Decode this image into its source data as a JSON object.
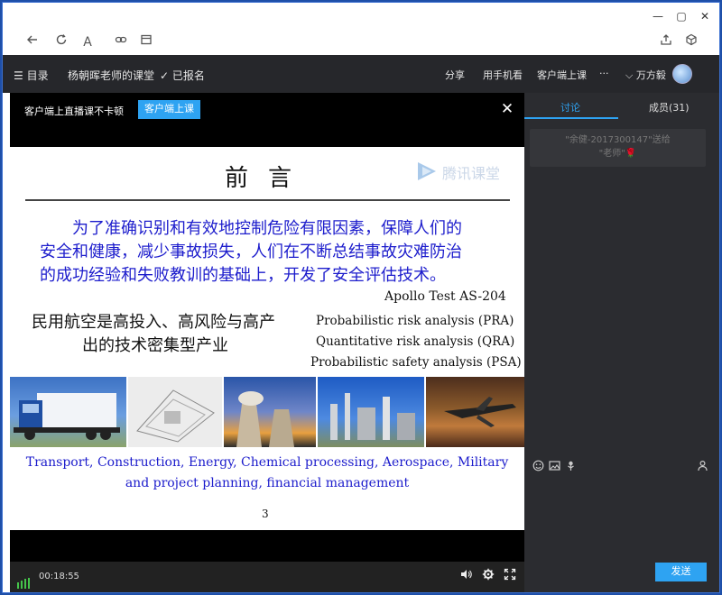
{
  "window": {
    "minimize": "—",
    "maximize": "▢",
    "close": "✕"
  },
  "toolbar": {
    "back_icon": "back-arrow-icon",
    "refresh_icon": "refresh-icon",
    "font_icon": "font-size-icon",
    "link_icon": "link-icon",
    "window_icon": "window-icon",
    "share_icon": "share-icon",
    "cube_icon": "cube-icon",
    "font_label": "A"
  },
  "navbar": {
    "menu_label": "☰ 目录",
    "course_title": "杨朝晖老师的课堂",
    "enrolled": "✓ 已报名",
    "share": "分享",
    "mobile": "用手机看",
    "client": "客户端上课",
    "more": "···",
    "user": "⌵ 万方毅"
  },
  "banner": {
    "text": "客户端上直播课不卡顿",
    "button": "客户端上课",
    "close": "✕"
  },
  "slide": {
    "title": "前言",
    "watermark": "腾讯课堂",
    "para_line1": "为了准确识别和有效地控制危险有限因素，保障人们的",
    "para_line2": "安全和健康，减少事故损失，人们在不断总结事故灾难防治",
    "para_line3": "的成功经验和失败教训的基础上，开发了安全评估技术。",
    "apollo": "Apollo Test AS-204",
    "civil_line1": "民用航空是高投入、高风险与高产",
    "civil_line2": "出的技术密集型产业",
    "risk_pra": "Probabilistic risk analysis (PRA)",
    "risk_qra": "Quantitative risk analysis (QRA)",
    "risk_psa": "Probabilistic safety analysis (PSA)",
    "caption1": "Transport, Construction, Energy, Chemical processing, Aerospace, Military",
    "caption2": "and project planning, financial management",
    "page": "3"
  },
  "controls": {
    "time": "00:18:55",
    "volume_icon": "volume-icon",
    "settings_icon": "gear-icon",
    "fullscreen_icon": "fullscreen-icon"
  },
  "panel": {
    "tab_discuss": "讨论",
    "tab_members": "成员(31)",
    "msg_line1": "\"余健-2017300147\"送给",
    "msg_line2": "\"老师\"🌹",
    "send": "发送"
  },
  "colors": {
    "accent": "#2ea3f2",
    "navbar": "#26272b",
    "panel": "#2b2c30",
    "slide_blue": "#1c1ccc"
  }
}
